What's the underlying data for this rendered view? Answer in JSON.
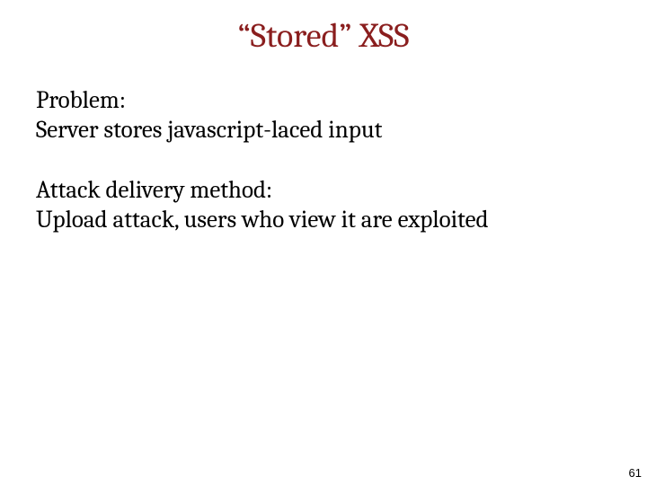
{
  "slide": {
    "title": "“Stored” XSS",
    "block1_line1": "Problem:",
    "block1_line2": "Server stores javascript-laced input",
    "block2_line1": "Attack delivery method:",
    "block2_line2": "Upload attack, users who view it are exploited",
    "page_number": "61"
  }
}
